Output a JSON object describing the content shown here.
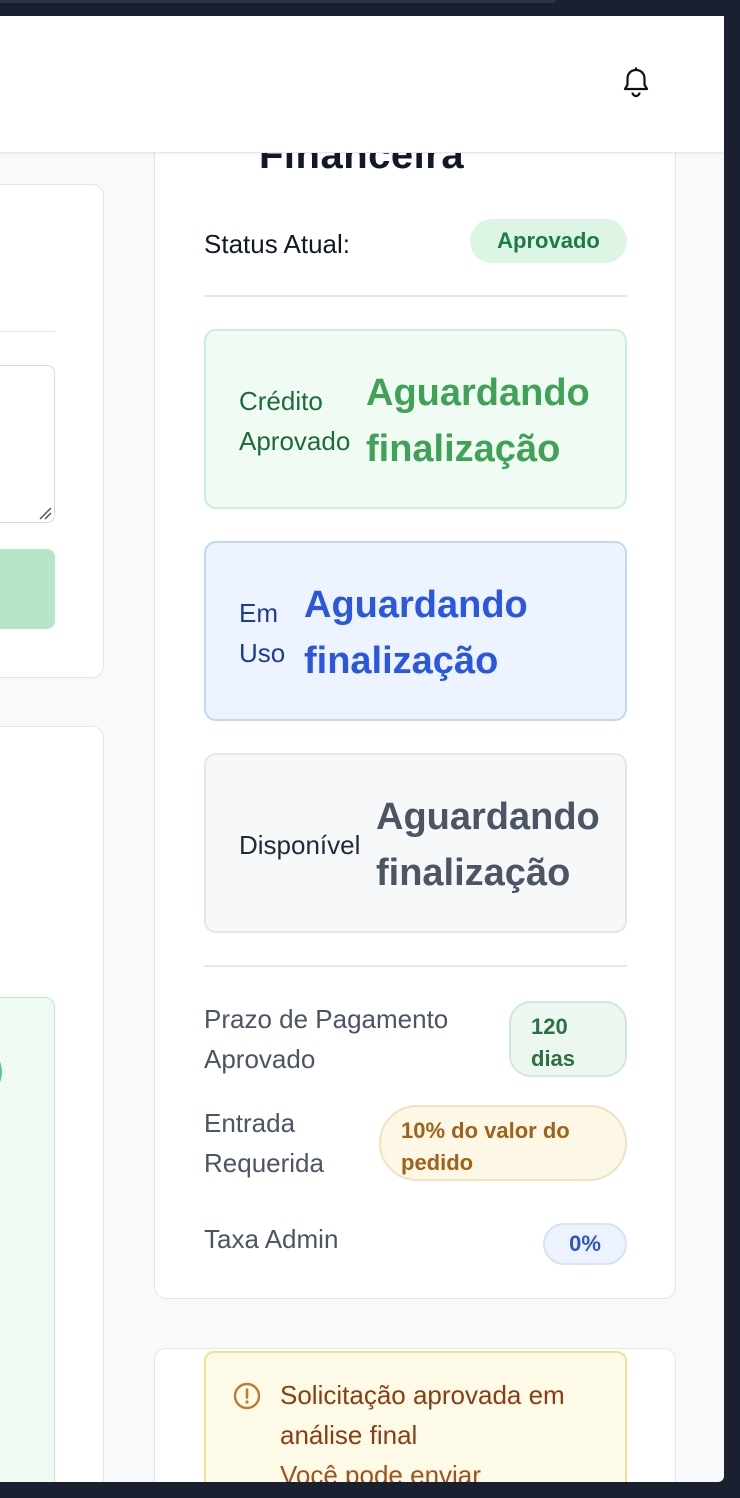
{
  "card": {
    "title_partial": "Financeira",
    "status_label": "Status Atual:",
    "status_value": "Aprovado"
  },
  "stats": [
    {
      "label_line1": "Crédito",
      "label_line2": "Aprovado",
      "value_line1": "Aguardando",
      "value_line2": "finalização"
    },
    {
      "label_line1": "Em",
      "label_line2": "Uso",
      "value_line1": "Aguardando",
      "value_line2": "finalização"
    },
    {
      "label_line1": "Disponível",
      "value_line1": "Aguardando",
      "value_line2": "finalização"
    }
  ],
  "terms": {
    "payment_label_line1": "Prazo de Pagamento",
    "payment_label_line2": "Aprovado",
    "payment_value_line1": "120",
    "payment_value_line2": "dias",
    "entry_label_line1": "Entrada",
    "entry_label_line2": "Requerida",
    "entry_value_line1": "10% do valor do",
    "entry_value_line2": "pedido",
    "fee_label": "Taxa Admin",
    "fee_value": "0%"
  },
  "alert": {
    "title": "Solicitação aprovada em análise final",
    "subtitle_partial": "Você pode enviar"
  },
  "colors": {
    "approved_green": "#3fa257",
    "in_use_blue": "#2b56e0",
    "available_gray": "#4b5563",
    "alert_brown": "#8a3d12"
  }
}
